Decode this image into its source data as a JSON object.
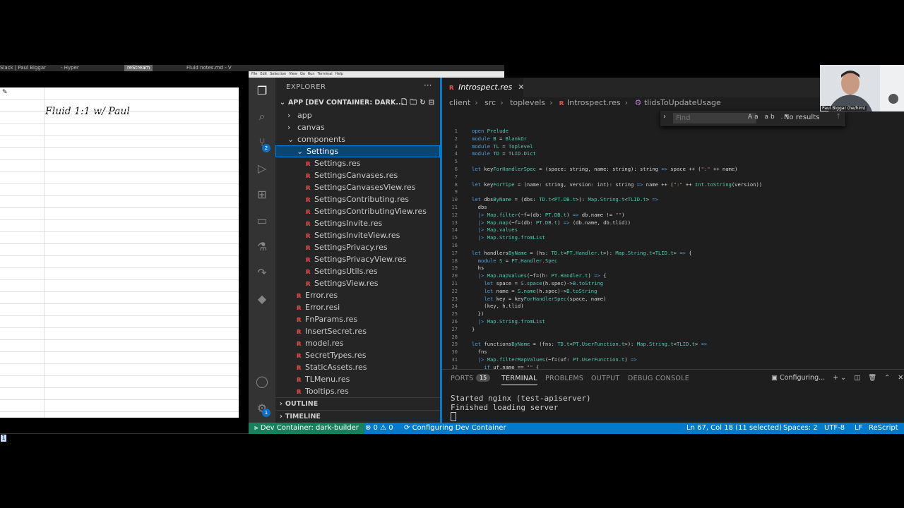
{
  "taskbar": {
    "items": [
      "Slack | Paul Biggar",
      "- Hyper",
      "reStream",
      "Fluid notes.md - V"
    ]
  },
  "notes": {
    "title": "Fluid 1:1 w/ Paul",
    "page_number": "1"
  },
  "menubar": [
    "File",
    "Edit",
    "Selection",
    "View",
    "Go",
    "Run",
    "Terminal",
    "Help"
  ],
  "activity_bar": {
    "source_control_badge": "2",
    "settings_badge": "1"
  },
  "sidebar": {
    "title": "EXPLORER",
    "more": "···",
    "project": "APP [DEV CONTAINER: DARK...",
    "tree": [
      {
        "label": "app",
        "type": "folder",
        "indent": 1,
        "open": false
      },
      {
        "label": "canvas",
        "type": "folder",
        "indent": 1,
        "open": false
      },
      {
        "label": "components",
        "type": "folder",
        "indent": 1,
        "open": true
      },
      {
        "label": "Settings",
        "type": "folder",
        "indent": 2,
        "open": true,
        "selected": true
      },
      {
        "label": "Settings.res",
        "type": "file",
        "indent": 3
      },
      {
        "label": "SettingsCanvases.res",
        "type": "file",
        "indent": 3
      },
      {
        "label": "SettingsCanvasesView.res",
        "type": "file",
        "indent": 3
      },
      {
        "label": "SettingsContributing.res",
        "type": "file",
        "indent": 3
      },
      {
        "label": "SettingsContributingView.res",
        "type": "file",
        "indent": 3
      },
      {
        "label": "SettingsInvite.res",
        "type": "file",
        "indent": 3
      },
      {
        "label": "SettingsInviteView.res",
        "type": "file",
        "indent": 3
      },
      {
        "label": "SettingsPrivacy.res",
        "type": "file",
        "indent": 3
      },
      {
        "label": "SettingsPrivacyView.res",
        "type": "file",
        "indent": 3
      },
      {
        "label": "SettingsUtils.res",
        "type": "file",
        "indent": 3
      },
      {
        "label": "SettingsView.res",
        "type": "file",
        "indent": 3
      },
      {
        "label": "Error.res",
        "type": "file",
        "indent": 2
      },
      {
        "label": "Error.resi",
        "type": "file",
        "indent": 2
      },
      {
        "label": "FnParams.res",
        "type": "file",
        "indent": 2
      },
      {
        "label": "InsertSecret.res",
        "type": "file",
        "indent": 2
      },
      {
        "label": "model.res",
        "type": "file",
        "indent": 2
      },
      {
        "label": "SecretTypes.res",
        "type": "file",
        "indent": 2
      },
      {
        "label": "StaticAssets.res",
        "type": "file",
        "indent": 2
      },
      {
        "label": "TLMenu.res",
        "type": "file",
        "indent": 2
      },
      {
        "label": "Tooltips.res",
        "type": "file",
        "indent": 2
      }
    ],
    "outline": "OUTLINE",
    "timeline": "TIMELINE"
  },
  "editor": {
    "tab": "Introspect.res",
    "breadcrumb": [
      "client",
      "src",
      "toplevels",
      "Introspect.res",
      "tlidsToUpdateUsage"
    ],
    "find": {
      "placeholder": "Find",
      "result": "No results",
      "options": "Aa ab .*"
    },
    "code": [
      "open Prelude",
      "module B = BlankOr",
      "module TL = Toplevel",
      "module TD = TLID.Dict",
      "",
      "let keyForHandlerSpec = (space: string, name: string): string => space ++ (\":\" ++ name)",
      "",
      "let keyForTipe = (name: string, version: int): string => name ++ (\":\" ++ Int.toString(version))",
      "",
      "let dbsByName = (dbs: TD.t<PT.DB.t>): Map.String.t<TLID.t> =>",
      "  dbs",
      "  |> Map.filter(~f=(db: PT.DB.t) => db.name != \"\")",
      "  |> Map.map(~f=(db: PT.DB.t) => (db.name, db.tlid))",
      "  |> Map.values",
      "  |> Map.String.fromList",
      "",
      "let handlersByName = (hs: TD.t<PT.Handler.t>): Map.String.t<TLID.t> => {",
      "  module S = PT.Handler.Spec",
      "  hs",
      "  |> Map.mapValues(~f=(h: PT.Handler.t) => {",
      "    let space = S.space(h.spec)->B.toString",
      "    let name = S.name(h.spec)->B.toString",
      "    let key = keyForHandlerSpec(space, name)",
      "    (key, h.tlid)",
      "  })",
      "  |> Map.String.fromList",
      "}",
      "",
      "let functionsByName = (fns: TD.t<PT.UserFunction.t>): Map.String.t<TLID.t> =>",
      "  fns",
      "  |> Map.filterMapValues(~f=(uf: PT.UserFunction.t) =>",
      "    if uf.name == \"\" {"
    ]
  },
  "panel": {
    "tabs": [
      "PORTS",
      "TERMINAL",
      "PROBLEMS",
      "OUTPUT",
      "DEBUG CONSOLE"
    ],
    "ports_count": "15",
    "active_tab": "TERMINAL",
    "terminal_task": "Configuring...",
    "terminal_lines": [
      "Started nginx (test-apiserver)",
      "Finished loading server"
    ]
  },
  "statusbar": {
    "remote": "Dev Container: dark-builder",
    "problems": "⊗ 0 ⚠ 0",
    "task": "Configuring Dev Container",
    "cursor": "Ln 67, Col 18 (11 selected)",
    "spaces": "Spaces: 2",
    "encoding": "UTF-8",
    "eol": "LF",
    "language": "ReScript"
  },
  "webcam": {
    "name": "Paul Biggar (he/him)"
  }
}
